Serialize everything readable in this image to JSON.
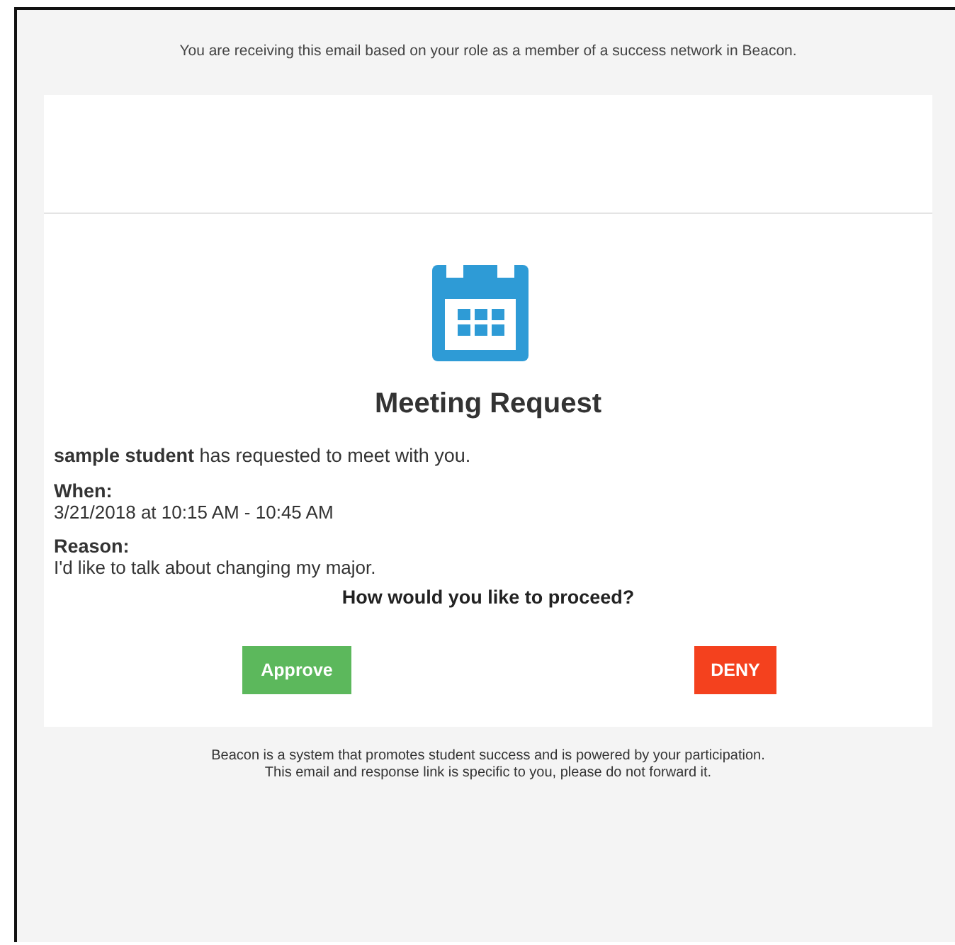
{
  "preheader": "You are receiving this email based on your role as a member of a success network in Beacon.",
  "title": "Meeting Request",
  "intro": "**sample student** has requested to meet with you.",
  "details": [
    {
      "label": "When:",
      "value": "3/21/2018 at 10:15 AM - 10:45 AM"
    },
    {
      "label": "Reason:",
      "value": "I'd like to talk about changing my major."
    }
  ],
  "prompt": "How would you like to proceed?",
  "buttons": [
    {
      "label": "Approve",
      "kind": "approve"
    },
    {
      "label": "DENY",
      "kind": "deny"
    }
  ],
  "footer": [
    "Beacon is a system that promotes student success and is powered by your participation.",
    "This email and response link is specific to you, please do not forward it."
  ]
}
